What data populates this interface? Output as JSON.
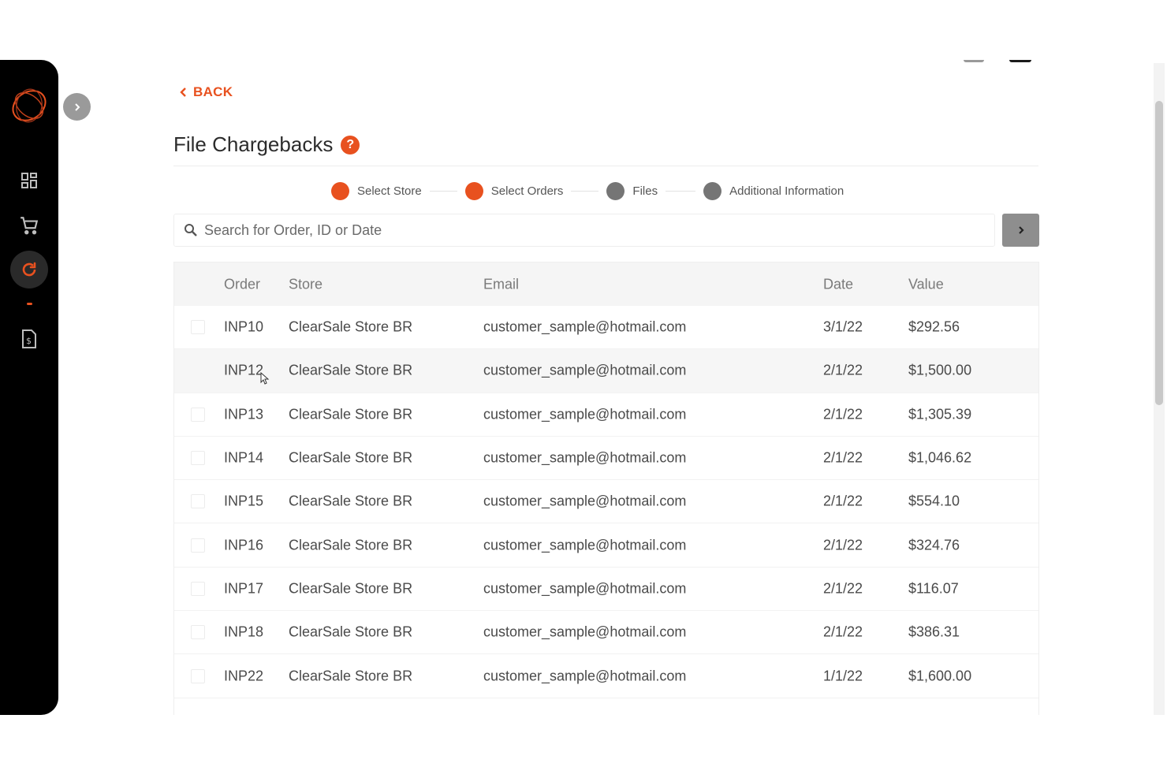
{
  "nav": {
    "back_label": "BACK"
  },
  "page": {
    "title": "File Chargebacks",
    "help_glyph": "?"
  },
  "stepper": {
    "steps": [
      {
        "label": "Select Store",
        "state": "done",
        "color": "#e8511f"
      },
      {
        "label": "Select Orders",
        "state": "active",
        "color": "#e8511f"
      },
      {
        "label": "Files",
        "state": "pending",
        "color": "#757575"
      },
      {
        "label": "Additional Information",
        "state": "pending",
        "color": "#757575"
      }
    ]
  },
  "search": {
    "placeholder": "Search for Order, ID or Date",
    "value": ""
  },
  "table": {
    "headers": {
      "order": "Order",
      "store": "Store",
      "email": "Email",
      "date": "Date",
      "value": "Value"
    },
    "rows": [
      {
        "order": "INP10",
        "store": "ClearSale Store BR",
        "email": "customer_sample@hotmail.com",
        "date": "3/1/22",
        "value": "$292.56"
      },
      {
        "order": "INP12",
        "store": "ClearSale Store BR",
        "email": "customer_sample@hotmail.com",
        "date": "2/1/22",
        "value": "$1,500.00"
      },
      {
        "order": "INP13",
        "store": "ClearSale Store BR",
        "email": "customer_sample@hotmail.com",
        "date": "2/1/22",
        "value": "$1,305.39"
      },
      {
        "order": "INP14",
        "store": "ClearSale Store BR",
        "email": "customer_sample@hotmail.com",
        "date": "2/1/22",
        "value": "$1,046.62"
      },
      {
        "order": "INP15",
        "store": "ClearSale Store BR",
        "email": "customer_sample@hotmail.com",
        "date": "2/1/22",
        "value": "$554.10"
      },
      {
        "order": "INP16",
        "store": "ClearSale Store BR",
        "email": "customer_sample@hotmail.com",
        "date": "2/1/22",
        "value": "$324.76"
      },
      {
        "order": "INP17",
        "store": "ClearSale Store BR",
        "email": "customer_sample@hotmail.com",
        "date": "2/1/22",
        "value": "$116.07"
      },
      {
        "order": "INP18",
        "store": "ClearSale Store BR",
        "email": "customer_sample@hotmail.com",
        "date": "2/1/22",
        "value": "$386.31"
      },
      {
        "order": "INP22",
        "store": "ClearSale Store BR",
        "email": "customer_sample@hotmail.com",
        "date": "1/1/22",
        "value": "$1,600.00"
      }
    ]
  },
  "sidebar": {
    "items": [
      {
        "icon": "dashboard-icon"
      },
      {
        "icon": "cart-icon"
      },
      {
        "icon": "refresh-icon",
        "active": true
      },
      {
        "icon": "invoice-icon"
      }
    ]
  },
  "colors": {
    "accent": "#e8511f",
    "sidebar_bg": "#000000",
    "pending_step": "#757575"
  }
}
